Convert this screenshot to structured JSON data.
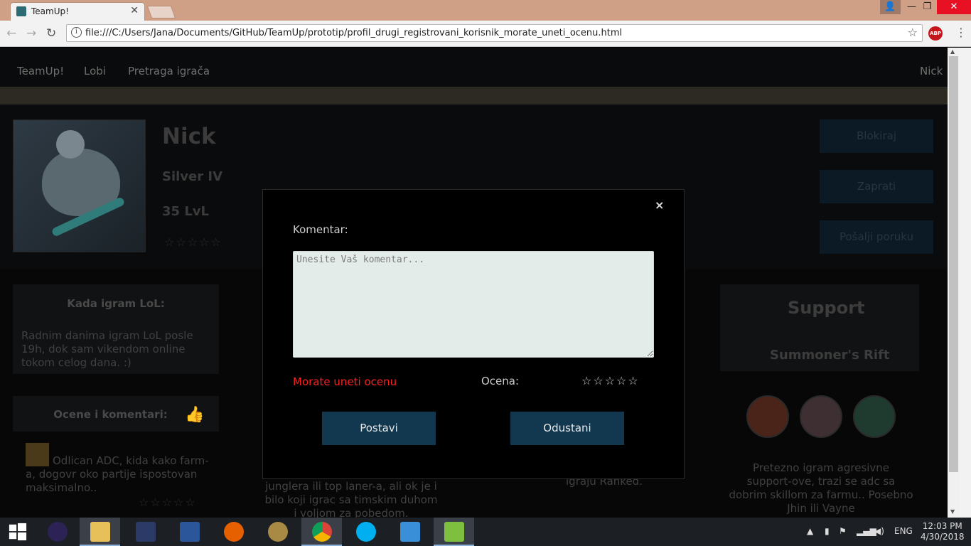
{
  "browser": {
    "tab_title": "TeamUp!",
    "url": "file:///C:/Users/Jana/Documents/GitHub/TeamUp/prototip/profil_drugi_registrovani_korisnik_morate_uneti_ocenu.html",
    "abp_label": "ABP"
  },
  "nav": {
    "brand": "TeamUp!",
    "lobby": "Lobi",
    "search": "Pretraga igrača",
    "user": "Nick"
  },
  "profile": {
    "name": "Nick",
    "rank": "Silver IV",
    "level": "35 LvL",
    "stars": "☆☆☆☆☆"
  },
  "actions": {
    "block": "Blokiraj",
    "follow": "Zaprati",
    "message": "Pošalji poruku"
  },
  "schedule": {
    "title": "Kada igram LoL:",
    "text": "Radnim danima igram LoL posle 19h, dok sam vikendom online tokom celog dana. :)"
  },
  "comments": {
    "title": "Ocene i komentari:",
    "items": [
      {
        "text": "Odlican ADC, kida kako farm-a, dogovr oko partije ispostovan maksimalno..",
        "stars": "☆☆☆☆☆"
      }
    ]
  },
  "middle": {
    "col1": "junglera ili top laner-a, ali ok je i bilo koji igrac sa timskim duhom i voljom za pobedom.",
    "col2": "igraju Ranked."
  },
  "role": {
    "title": "Support",
    "map": "Summoner's Rift",
    "text": "Pretezno igram agresivne support-ove, trazi se adc sa dobrim skillom za farmu.. Posebno Jhin ili Vayne"
  },
  "modal": {
    "close": "×",
    "comment_label": "Komentar:",
    "comment_placeholder": "Unesite Vaš komentar...",
    "error": "Morate uneti ocenu",
    "rating_label": "Ocena:",
    "rating_stars": "☆☆☆☆☆",
    "submit": "Postavi",
    "cancel": "Odustani"
  },
  "taskbar": {
    "lang": "ENG",
    "time": "12:03 PM",
    "date": "4/30/2018"
  }
}
